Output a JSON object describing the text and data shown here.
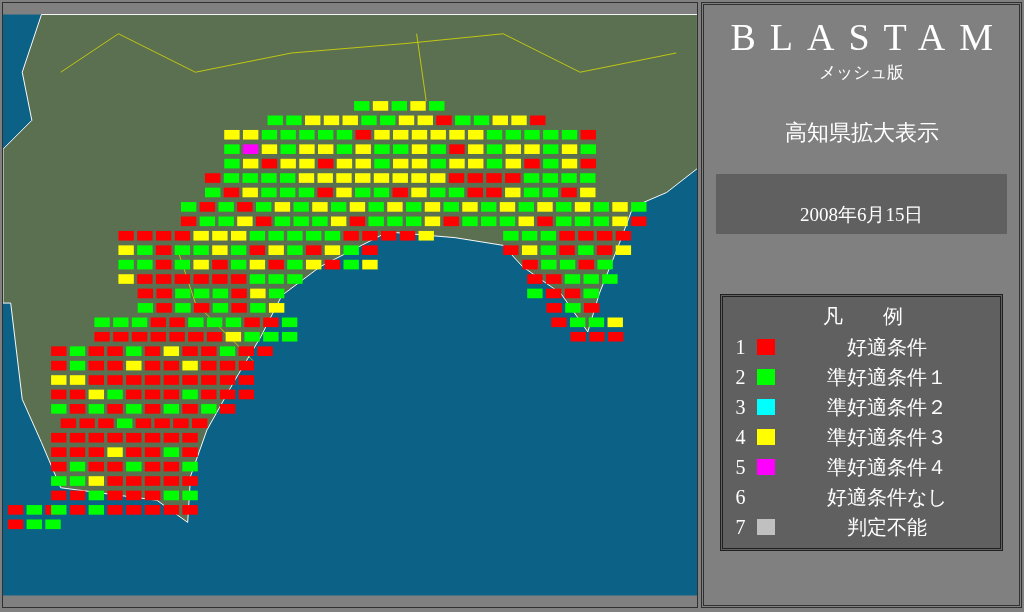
{
  "app": {
    "title": "BLASTAM",
    "subtitle": "メッシュ版"
  },
  "view_title": "高知県拡大表示",
  "date": "2008年6月15日",
  "legend": {
    "title": "凡　　例",
    "items": [
      {
        "number": "1",
        "color": "#ff0000",
        "label": "好適条件"
      },
      {
        "number": "2",
        "color": "#00ff00",
        "label": "準好適条件１"
      },
      {
        "number": "3",
        "color": "#00ffff",
        "label": "準好適条件２"
      },
      {
        "number": "4",
        "color": "#ffff00",
        "label": "準好適条件３"
      },
      {
        "number": "5",
        "color": "#ff00ff",
        "label": "準好適条件４"
      },
      {
        "number": "6",
        "label": "好適条件なし"
      },
      {
        "number": "7",
        "color": "#c0c0c0",
        "label": "判定不能"
      }
    ]
  }
}
